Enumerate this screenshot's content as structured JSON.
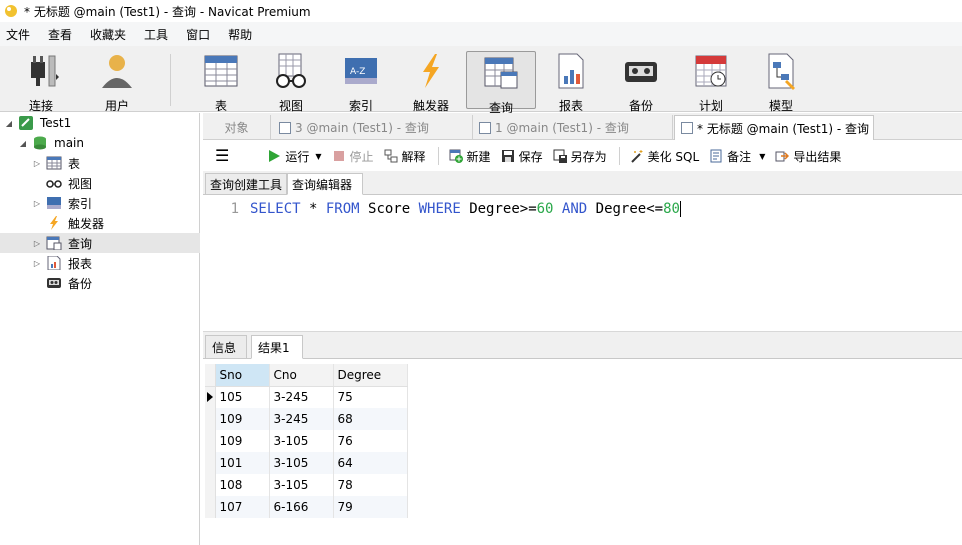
{
  "window": {
    "title": "* 无标题 @main (Test1) - 查询 - Navicat Premium"
  },
  "menu": [
    "文件",
    "查看",
    "收藏夹",
    "工具",
    "窗口",
    "帮助"
  ],
  "toolbar": {
    "connect": "连接",
    "user": "用户",
    "table": "表",
    "view": "视图",
    "index": "索引",
    "trigger": "触发器",
    "query": "查询",
    "report": "报表",
    "backup": "备份",
    "schedule": "计划",
    "model": "模型"
  },
  "tree": {
    "connection": "Test1",
    "database": "main",
    "items": [
      "表",
      "视图",
      "索引",
      "触发器",
      "查询",
      "报表",
      "备份"
    ]
  },
  "tabs": [
    "对象",
    "3 @main (Test1) - 查询",
    "1 @main (Test1) - 查询",
    "* 无标题 @main (Test1) - 查询"
  ],
  "query_toolbar": {
    "run": "运行",
    "stop": "停止",
    "explain": "解释",
    "new": "新建",
    "save": "保存",
    "save_as": "另存为",
    "beautify": "美化 SQL",
    "note": "备注",
    "export": "导出结果"
  },
  "subtabs": [
    "查询创建工具",
    "查询编辑器"
  ],
  "editor": {
    "line_no": "1",
    "tokens": [
      "SELECT",
      " * ",
      "FROM",
      " Score ",
      "WHERE",
      " Degree>=",
      "60",
      " ",
      "AND",
      " Degree<=",
      "80"
    ]
  },
  "result_tabs": [
    "信息",
    "结果1"
  ],
  "result": {
    "columns": [
      "Sno",
      "Cno",
      "Degree"
    ],
    "rows": [
      [
        "105",
        "3-245",
        "75"
      ],
      [
        "109",
        "3-245",
        "68"
      ],
      [
        "109",
        "3-105",
        "76"
      ],
      [
        "101",
        "3-105",
        "64"
      ],
      [
        "108",
        "3-105",
        "78"
      ],
      [
        "107",
        "6-166",
        "79"
      ]
    ]
  },
  "colors": {
    "keyword": "#3355cc",
    "number": "#2aa84a",
    "run_green": "#2fa536"
  }
}
